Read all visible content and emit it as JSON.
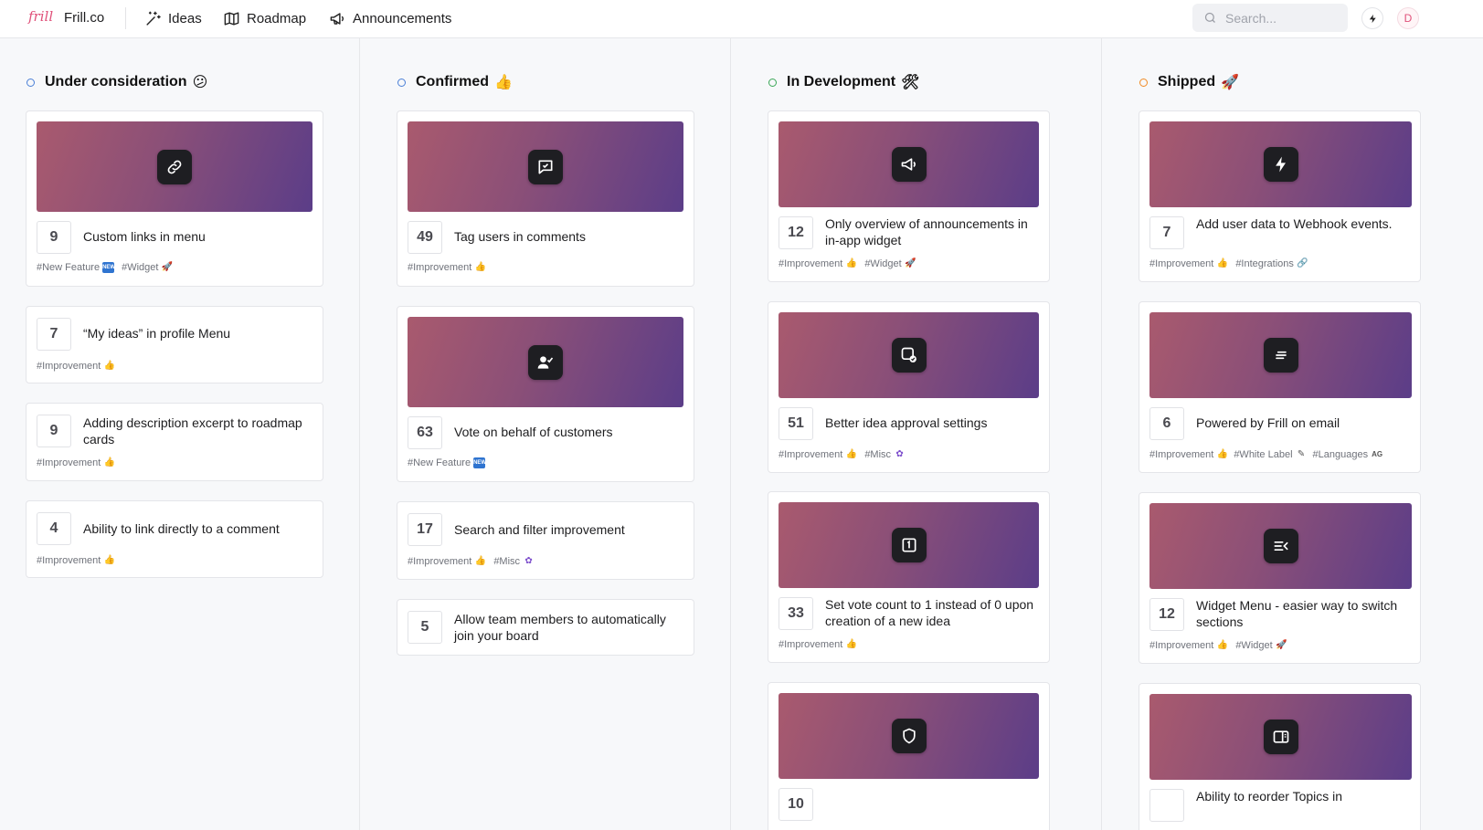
{
  "app": {
    "logo_text": "frill",
    "brand": "Frill.co",
    "nav": [
      {
        "label": "Ideas",
        "icon": "sparkle-wand-icon"
      },
      {
        "label": "Roadmap",
        "icon": "map-icon"
      },
      {
        "label": "Announcements",
        "icon": "megaphone-icon"
      }
    ],
    "search": {
      "placeholder": "Search...",
      "value": ""
    },
    "avatar_initial": "D",
    "accent": "#e0517a"
  },
  "columns": [
    {
      "title": "Under consideration",
      "emoji": "😕",
      "dot_color": "#4a7fd6",
      "cards": [
        {
          "votes": "9",
          "title": "Custom links in menu",
          "cover_icon": "link-icon",
          "tags": [
            {
              "label": "#New Feature",
              "emoji": "new-icon"
            },
            {
              "label": "#Widget",
              "emoji": "rocket-icon"
            }
          ]
        },
        {
          "votes": "7",
          "title": "“My ideas” in profile Menu",
          "tags": [
            {
              "label": "#Improvement",
              "emoji": "thumbs-up-icon"
            }
          ]
        },
        {
          "votes": "9",
          "title": "Adding description excerpt to roadmap cards",
          "tags": [
            {
              "label": "#Improvement",
              "emoji": "thumbs-up-icon"
            }
          ]
        },
        {
          "votes": "4",
          "title": "Ability to link directly to a comment",
          "tags": [
            {
              "label": "#Improvement",
              "emoji": "thumbs-up-icon"
            }
          ]
        }
      ]
    },
    {
      "title": "Confirmed",
      "emoji": "👍",
      "dot_color": "#4a7fd6",
      "cards": [
        {
          "votes": "49",
          "title": "Tag users in comments",
          "cover_icon": "comment-check-icon",
          "tags": [
            {
              "label": "#Improvement",
              "emoji": "thumbs-up-icon"
            }
          ]
        },
        {
          "votes": "63",
          "title": "Vote on behalf of customers",
          "cover_icon": "user-check-icon",
          "tags": [
            {
              "label": "#New Feature",
              "emoji": "new-icon"
            }
          ]
        },
        {
          "votes": "17",
          "title": "Search and filter improvement",
          "tags": [
            {
              "label": "#Improvement",
              "emoji": "thumbs-up-icon"
            },
            {
              "label": "#Misc",
              "emoji": "misc-icon"
            }
          ]
        },
        {
          "votes": "5",
          "title": "Allow team members to automatically join your board",
          "tags": []
        }
      ]
    },
    {
      "title": "In Development",
      "emoji": "🛠",
      "dot_color": "#3aa757",
      "cards": [
        {
          "votes": "12",
          "title": "Only overview of announcements in in-app widget",
          "cover_icon": "megaphone-icon",
          "tags": [
            {
              "label": "#Improvement",
              "emoji": "thumbs-up-icon"
            },
            {
              "label": "#Widget",
              "emoji": "rocket-icon"
            }
          ]
        },
        {
          "votes": "51",
          "title": "Better idea approval settings",
          "cover_icon": "approval-icon",
          "tags": [
            {
              "label": "#Improvement",
              "emoji": "thumbs-up-icon"
            },
            {
              "label": "#Misc",
              "emoji": "misc-icon"
            }
          ]
        },
        {
          "votes": "33",
          "title": "Set vote count to 1 instead of 0 upon creation of a new idea",
          "cover_icon": "number-one-icon",
          "tags": [
            {
              "label": "#Improvement",
              "emoji": "thumbs-up-icon"
            }
          ]
        },
        {
          "votes": "10",
          "title": "",
          "cover_icon": "shield-icon",
          "tags": []
        }
      ]
    },
    {
      "title": "Shipped",
      "emoji": "🚀",
      "dot_color": "#f08a24",
      "cards": [
        {
          "votes": "7",
          "title": "Add user data to Webhook events.",
          "cover_icon": "bolt-icon",
          "tags": [
            {
              "label": "#Improvement",
              "emoji": "thumbs-up-icon"
            },
            {
              "label": "#Integrations",
              "emoji": "link-icon"
            }
          ]
        },
        {
          "votes": "6",
          "title": "Powered by Frill on email",
          "cover_icon": "text-lines-icon",
          "tags": [
            {
              "label": "#Improvement",
              "emoji": "thumbs-up-icon"
            },
            {
              "label": "#White Label",
              "emoji": "pen-icon"
            },
            {
              "label": "#Languages",
              "emoji": "language-icon"
            }
          ]
        },
        {
          "votes": "12",
          "title": "Widget Menu - easier way to switch sections",
          "cover_icon": "menu-arrow-icon",
          "tags": [
            {
              "label": "#Improvement",
              "emoji": "thumbs-up-icon"
            },
            {
              "label": "#Widget",
              "emoji": "rocket-icon"
            }
          ]
        },
        {
          "votes": "",
          "title": "Ability to reorder Topics in",
          "cover_icon": "sidebar-panel-icon",
          "tags": []
        }
      ]
    }
  ]
}
